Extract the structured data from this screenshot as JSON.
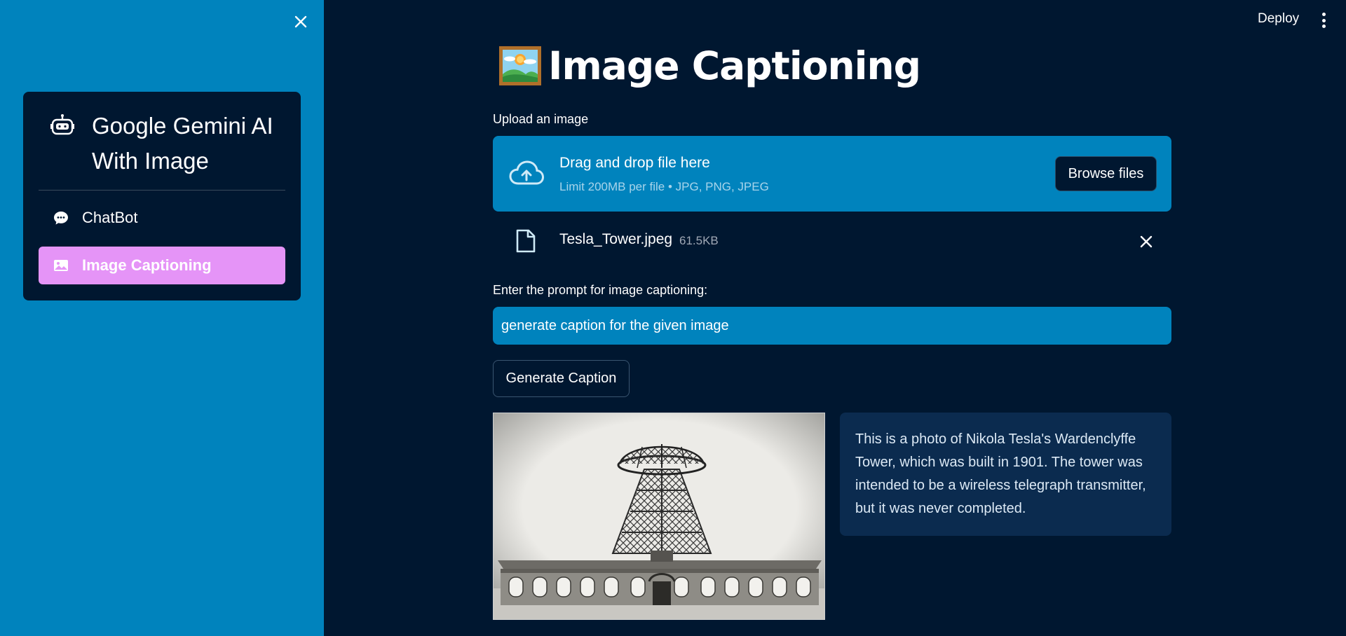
{
  "sidebar": {
    "menu_title": "Google Gemini AI With Image",
    "items": [
      {
        "label": "ChatBot",
        "icon": "chat-icon",
        "active": false
      },
      {
        "label": "Image Captioning",
        "icon": "image-icon",
        "active": true
      }
    ],
    "accent_color": "#e594f7",
    "background_color": "#0083bd"
  },
  "header": {
    "deploy_label": "Deploy"
  },
  "main": {
    "title": "Image Captioning",
    "title_icon": "framed-picture-icon",
    "uploader": {
      "label": "Upload an image",
      "drop_title": "Drag and drop file here",
      "drop_hint": "Limit 200MB per file • JPG, PNG, JPEG",
      "browse_label": "Browse files"
    },
    "uploaded_file": {
      "name": "Tesla_Tower.jpeg",
      "size": "61.5KB"
    },
    "prompt": {
      "label": "Enter the prompt for image captioning:",
      "value": "generate caption for the given image"
    },
    "generate_label": "Generate Caption",
    "caption": "This is a photo of Nikola Tesla's Wardenclyffe Tower, which was built in 1901. The tower was intended to be a wireless telegraph transmitter, but it was never completed."
  }
}
